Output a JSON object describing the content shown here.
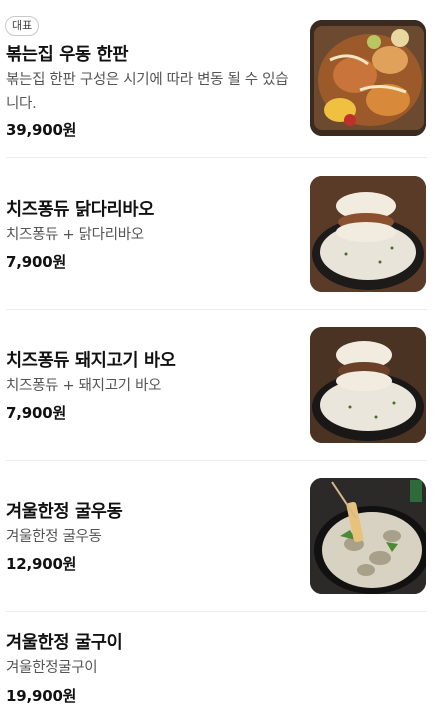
{
  "menu": {
    "items": [
      {
        "badge": "대표",
        "name": "볶는집 우동 한판",
        "description": "볶는집 한판 구성은 시기에 따라 변동 될 수 있습니다.",
        "price": "39,900원",
        "image_icon": "stir-fry-platter"
      },
      {
        "name": "치즈퐁듀 닭다리바오",
        "description": "치즈퐁듀 + 닭다리바오",
        "price": "7,900원",
        "image_icon": "chicken-bao-fondue"
      },
      {
        "name": "치즈퐁듀 돼지고기 바오",
        "description": "치즈퐁듀 + 돼지고기 바오",
        "price": "7,900원",
        "image_icon": "pork-bao-fondue"
      },
      {
        "name": "겨울한정 굴우동",
        "description": "겨울한정 굴우동",
        "price": "12,900원",
        "image_icon": "oyster-udon"
      },
      {
        "name": "겨울한정 굴구이",
        "description": "겨울한정굴구이",
        "price": "19,900원"
      }
    ]
  }
}
